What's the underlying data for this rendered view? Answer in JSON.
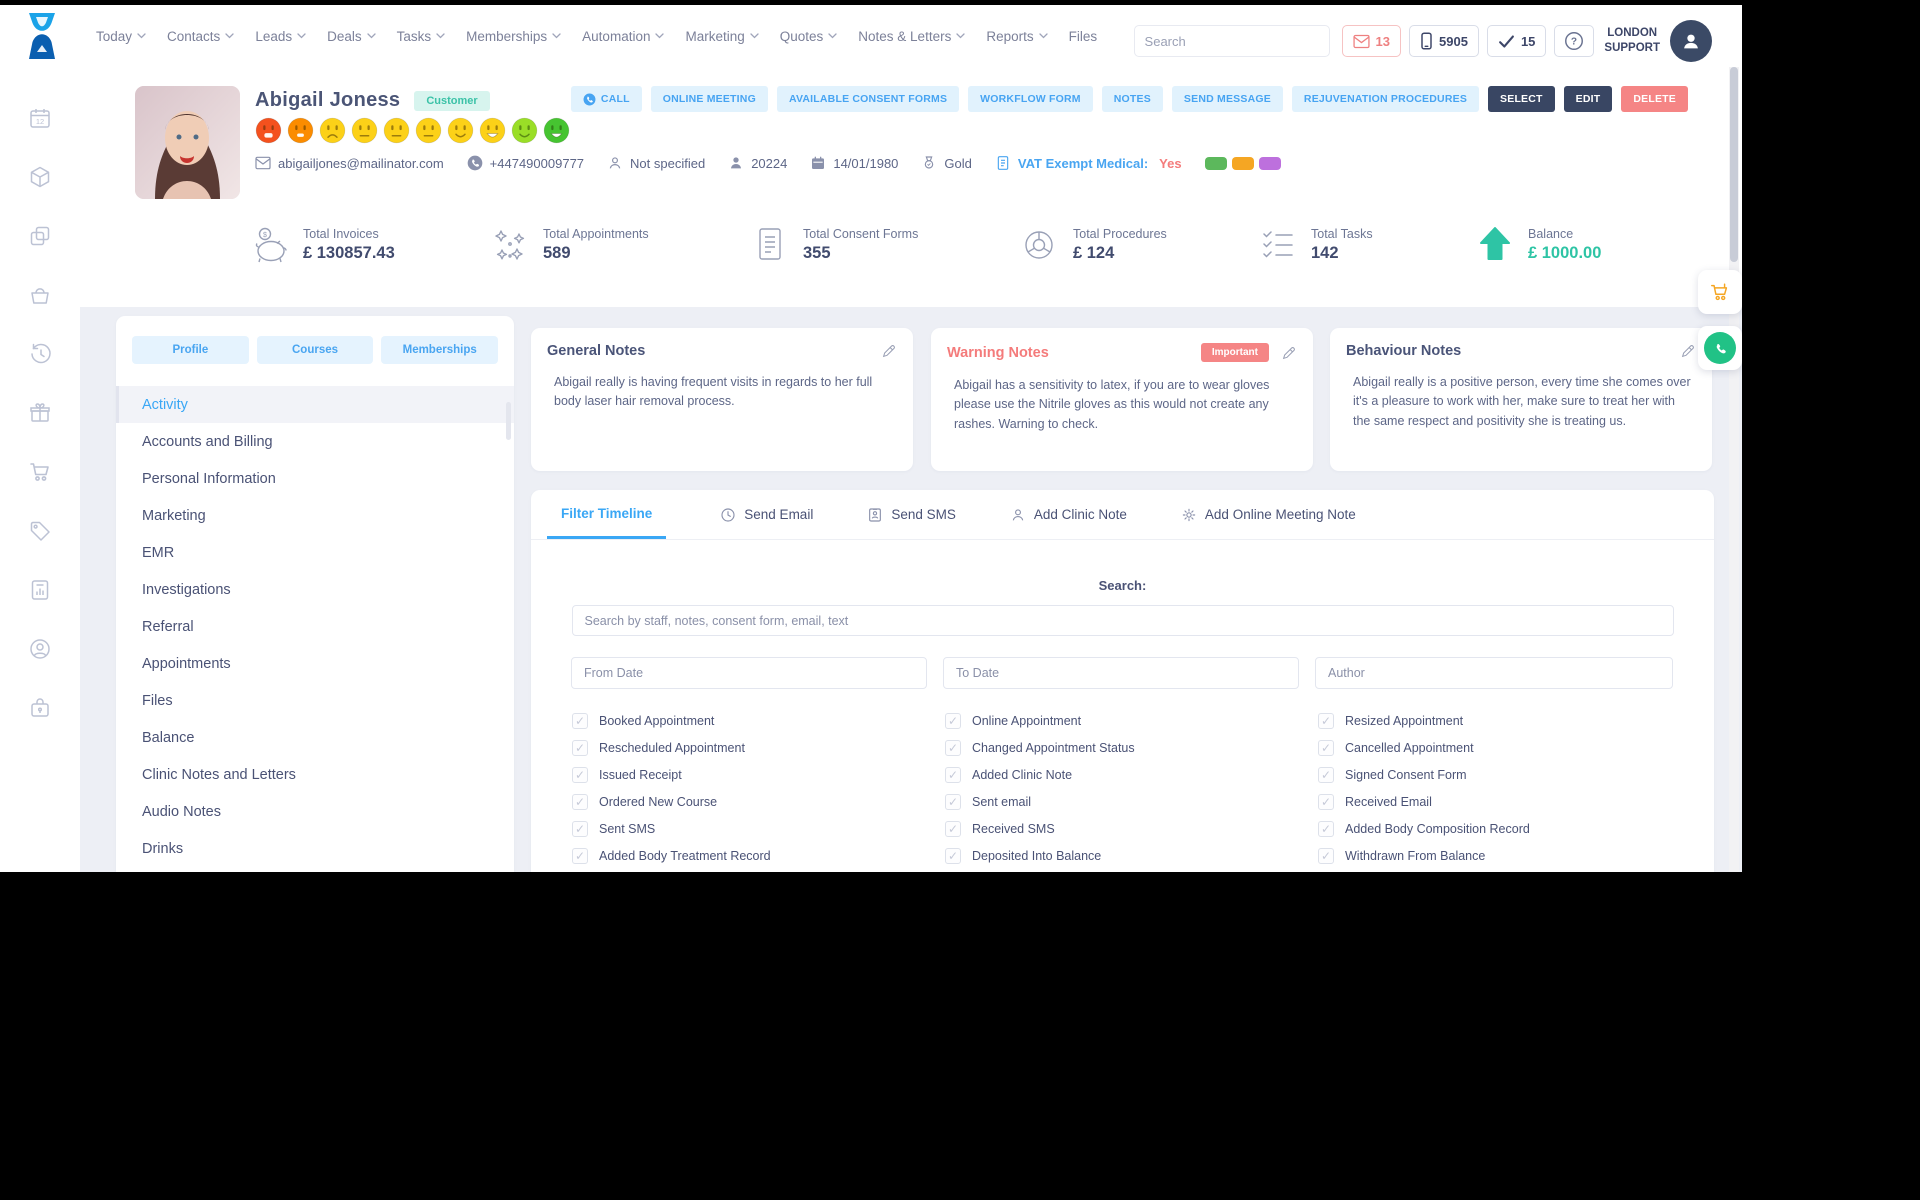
{
  "topbar": {
    "nav": [
      "Today",
      "Contacts",
      "Leads",
      "Deals",
      "Tasks",
      "Memberships",
      "Automation",
      "Marketing",
      "Quotes",
      "Notes & Letters",
      "Reports",
      "Files"
    ],
    "search_placeholder": "Search",
    "mail_count": "13",
    "phone_count": "5905",
    "task_count": "15",
    "user_line1": "LONDON",
    "user_line2": "SUPPORT"
  },
  "sidebar_icons": [
    "calendar-icon",
    "package-icon",
    "copy-icon",
    "basket-icon",
    "history-icon",
    "gift-icon",
    "cart-icon",
    "tag-icon",
    "report-icon",
    "account-icon",
    "lock-icon"
  ],
  "client": {
    "name": "Abigail Joness",
    "type_badge": "Customer",
    "email": "abigailjones@mailinator.com",
    "phone": "+447490009777",
    "gender": "Not specified",
    "id": "20224",
    "dob": "14/01/1980",
    "tier": "Gold",
    "vat_label": "VAT Exempt Medical:",
    "vat_value": "Yes",
    "tag_colors": [
      "#5cb85c",
      "#f5a623",
      "#bd70dd"
    ],
    "emojis": [
      "#f4511e",
      "#fb8c00",
      "#fcd118",
      "#fcd118",
      "#fcd118",
      "#fcd118",
      "#fcd118",
      "#fcd118",
      "#9ade27",
      "#46c431"
    ]
  },
  "actions": [
    {
      "label": "CALL"
    },
    {
      "label": "ONLINE MEETING"
    },
    {
      "label": "AVAILABLE CONSENT FORMS"
    },
    {
      "label": "WORKFLOW FORM"
    },
    {
      "label": "NOTES"
    },
    {
      "label": "SEND MESSAGE"
    },
    {
      "label": "REJUVENATION PROCEDURES"
    },
    {
      "label": "SELECT"
    },
    {
      "label": "EDIT"
    },
    {
      "label": "DELETE"
    }
  ],
  "stats": [
    {
      "label": "Total Invoices",
      "value": "£ 130857.43"
    },
    {
      "label": "Total Appointments",
      "value": "589"
    },
    {
      "label": "Total Consent Forms",
      "value": "355"
    },
    {
      "label": "Total Procedures",
      "value": "£ 124"
    },
    {
      "label": "Total Tasks",
      "value": "142"
    },
    {
      "label": "Balance",
      "value": "£ 1000.00"
    }
  ],
  "profile_nav": {
    "tabs": [
      "Profile",
      "Courses",
      "Memberships"
    ],
    "items": [
      "Activity",
      "Accounts and Billing",
      "Personal Information",
      "Marketing",
      "EMR",
      "Investigations",
      "Referral",
      "Appointments",
      "Files",
      "Balance",
      "Clinic Notes and Letters",
      "Audio Notes",
      "Drinks"
    ]
  },
  "notes": {
    "general": {
      "title": "General Notes",
      "body": "Abigail really is having frequent visits in regards to her full body laser hair removal process."
    },
    "warning": {
      "title": "Warning Notes",
      "badge": "Important",
      "body": "Abigail has a sensitivity to latex, if you are to wear gloves please use the Nitrile gloves as this would not create any rashes. Warning to check."
    },
    "behaviour": {
      "title": "Behaviour Notes",
      "body": "Abigail really is a positive person, every time she comes over it's a pleasure to work with her, make sure to treat her with the same respect and positivity she is treating us."
    }
  },
  "timeline": {
    "tabs": [
      "Filter Timeline",
      "Send Email",
      "Send SMS",
      "Add Clinic Note",
      "Add Online Meeting Note"
    ],
    "search_label": "Search:",
    "search_placeholder": "Search by staff, notes, consent form, email, text",
    "from_placeholder": "From Date",
    "to_placeholder": "To Date",
    "author_placeholder": "Author",
    "all_checked": true,
    "checkboxes": [
      [
        "Booked Appointment",
        "Rescheduled Appointment",
        "Issued Receipt",
        "Ordered New Course",
        "Sent SMS",
        "Added Body Treatment Record"
      ],
      [
        "Online Appointment",
        "Changed Appointment Status",
        "Added Clinic Note",
        "Sent email",
        "Received SMS",
        "Deposited Into Balance"
      ],
      [
        "Resized Appointment",
        "Cancelled Appointment",
        "Signed Consent Form",
        "Received Email",
        "Added Body Composition Record",
        "Withdrawn From Balance"
      ]
    ]
  },
  "colors": {
    "accent_blue": "#3aa7f5",
    "navy": "#394663",
    "danger": "#f58585",
    "teal": "#2ec4a5",
    "orange": "#f5a623",
    "whatsapp_green": "#21c286"
  }
}
